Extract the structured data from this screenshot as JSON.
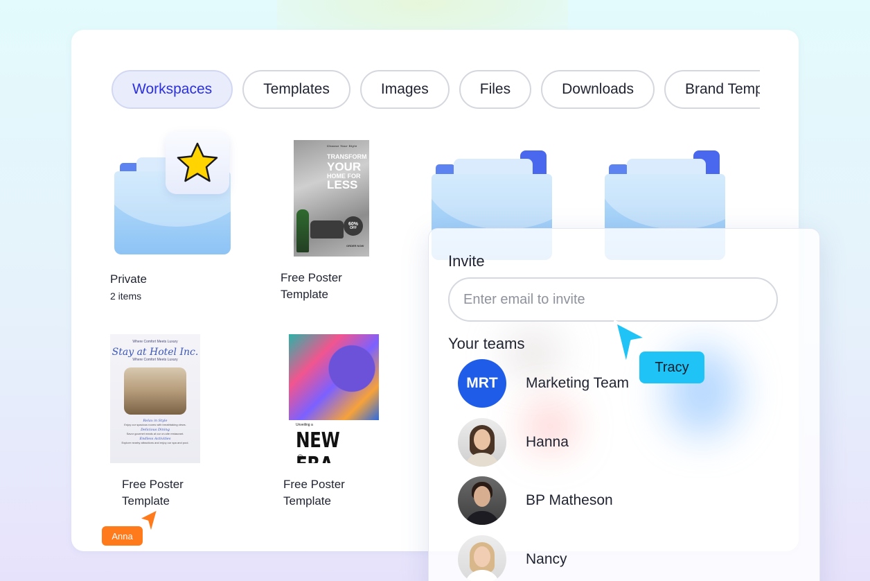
{
  "tabs": [
    {
      "label": "Workspaces",
      "active": true
    },
    {
      "label": "Templates",
      "active": false
    },
    {
      "label": "Images",
      "active": false
    },
    {
      "label": "Files",
      "active": false
    },
    {
      "label": "Downloads",
      "active": false
    },
    {
      "label": "Brand Templates",
      "active": false
    }
  ],
  "items": {
    "private": {
      "label": "Private",
      "count": "2 items",
      "icon": "star-icon"
    },
    "poster_home": {
      "label": "Free Poster Template",
      "poster": {
        "top": "Choose Your Style",
        "lines": [
          "TRANSFORM",
          "YOUR",
          "HOME FOR",
          "LESS"
        ],
        "badge_percent": "60%",
        "badge_off": "OFF",
        "cta": "ORDER NOW"
      }
    },
    "poster_hotel": {
      "label": "Free Poster Template",
      "poster": {
        "tagline": "Where Comfort Meets Luxury",
        "title": "Stay at Hotel Inc.",
        "sub": "Where Comfort Meets Luxury",
        "sections": [
          {
            "head": "Relax in Style",
            "text": "Enjoy our spacious rooms with breathtaking views."
          },
          {
            "head": "Delicious Dining",
            "text": "Savor gourmet meals at our on-site restaurant."
          },
          {
            "head": "Endless Activities",
            "text": "Explore nearby attractions and enjoy our spa and pool."
          }
        ]
      }
    },
    "poster_era": {
      "label": "Free Poster Template",
      "poster": {
        "kicker": "Unveiling a",
        "title": "NEW ERA"
      }
    }
  },
  "invite": {
    "title": "Invite",
    "placeholder": "Enter email to invite",
    "teams_title": "Your teams",
    "members": [
      {
        "name": "Marketing Team",
        "initials": "MRT",
        "kind": "team"
      },
      {
        "name": "Hanna",
        "kind": "photo"
      },
      {
        "name": "BP Matheson",
        "kind": "photo"
      },
      {
        "name": "Nancy",
        "kind": "photo"
      }
    ]
  },
  "cursors": [
    {
      "user": "Tracy",
      "color": "#1fc3f5"
    },
    {
      "user": "Anna",
      "color": "#ff7a1a"
    }
  ],
  "colors": {
    "accent": "#2b2fe0",
    "team_avatar": "#1f5de8",
    "folder_blue": "#9fcdf8",
    "star": "#ffd400"
  }
}
